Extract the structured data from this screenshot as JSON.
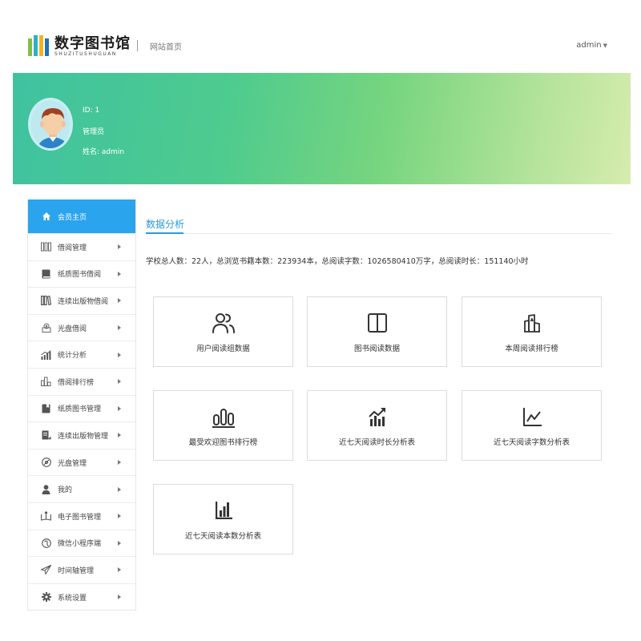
{
  "header": {
    "logo_title": "数字图书馆",
    "logo_subtitle": "SHUZITUSHUGUAN",
    "home_link": "网站首页",
    "user_menu": "admin"
  },
  "profile": {
    "id_line": "ID: 1",
    "role": "管理员",
    "name_line": "姓名: admin"
  },
  "sidebar": {
    "items": [
      {
        "label": "会员主页",
        "icon": "home-icon"
      },
      {
        "label": "借阅管理",
        "icon": "bookshelf-icon"
      },
      {
        "label": "纸质图书借阅",
        "icon": "book-icon"
      },
      {
        "label": "连续出版物借阅",
        "icon": "books-stack-icon"
      },
      {
        "label": "光盘借阅",
        "icon": "disc-tray-icon"
      },
      {
        "label": "统计分析",
        "icon": "stats-chart-icon"
      },
      {
        "label": "借阅排行榜",
        "icon": "ranking-icon"
      },
      {
        "label": "纸质图书管理",
        "icon": "bookmark-book-icon"
      },
      {
        "label": "连续出版物管理",
        "icon": "document-edit-icon"
      },
      {
        "label": "光盘管理",
        "icon": "disc-icon"
      },
      {
        "label": "我的",
        "icon": "user-icon"
      },
      {
        "label": "电子图书管理",
        "icon": "ebook-icon"
      },
      {
        "label": "微信小程序端",
        "icon": "wechat-icon"
      },
      {
        "label": "时间轴管理",
        "icon": "timeline-icon"
      },
      {
        "label": "系统设置",
        "icon": "gear-icon"
      }
    ]
  },
  "main": {
    "section_title": "数据分析",
    "stats": "学校总人数：22人，总浏览书籍本数：223934本，总阅读字数：1026580410万字，总阅读时长：151140小时",
    "cards": [
      {
        "label": "用户阅读组数据",
        "icon": "users-icon"
      },
      {
        "label": "图书阅读数据",
        "icon": "open-book-icon"
      },
      {
        "label": "本周阅读排行榜",
        "icon": "podium-icon"
      },
      {
        "label": "最受欢迎图书排行榜",
        "icon": "bar-chart-icon"
      },
      {
        "label": "近七天阅读时长分析表",
        "icon": "trending-bars-icon"
      },
      {
        "label": "近七天阅读字数分析表",
        "icon": "line-chart-icon"
      },
      {
        "label": "近七天阅读本数分析表",
        "icon": "column-chart-icon"
      }
    ]
  },
  "colors": {
    "accent": "#2aa4ed",
    "banner_start": "#3fc2a0",
    "banner_end": "#d6ecae"
  }
}
